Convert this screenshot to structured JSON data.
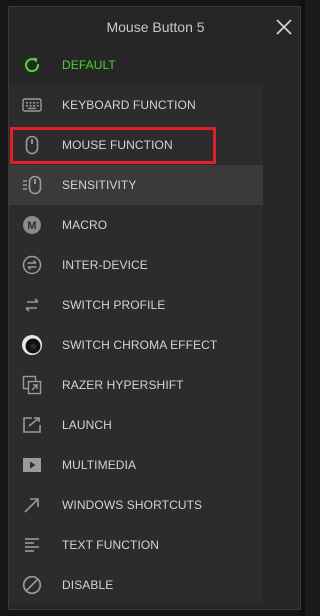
{
  "window": {
    "title": "Mouse Button 5"
  },
  "menu": {
    "default_label": "DEFAULT",
    "items": [
      {
        "label": "KEYBOARD FUNCTION",
        "icon": "keyboard-icon"
      },
      {
        "label": "MOUSE FUNCTION",
        "icon": "mouse-icon"
      },
      {
        "label": "SENSITIVITY",
        "icon": "sensitivity-icon",
        "active": true
      },
      {
        "label": "MACRO",
        "icon": "macro-icon"
      },
      {
        "label": "INTER-DEVICE",
        "icon": "inter-device-icon"
      },
      {
        "label": "SWITCH PROFILE",
        "icon": "switch-profile-icon"
      },
      {
        "label": "SWITCH CHROMA EFFECT",
        "icon": "chroma-icon"
      },
      {
        "label": "RAZER HYPERSHIFT",
        "icon": "hypershift-icon"
      },
      {
        "label": "LAUNCH",
        "icon": "launch-icon"
      },
      {
        "label": "MULTIMEDIA",
        "icon": "multimedia-icon"
      },
      {
        "label": "WINDOWS SHORTCUTS",
        "icon": "windows-shortcuts-icon"
      },
      {
        "label": "TEXT FUNCTION",
        "icon": "text-function-icon"
      },
      {
        "label": "DISABLE",
        "icon": "disable-icon"
      }
    ]
  },
  "colors": {
    "accent_green": "#44d62c",
    "highlight_red": "#e0202a",
    "panel_bg": "#262626",
    "menu_bg": "#2c2c2c",
    "active_bg": "#3a3a3a"
  }
}
